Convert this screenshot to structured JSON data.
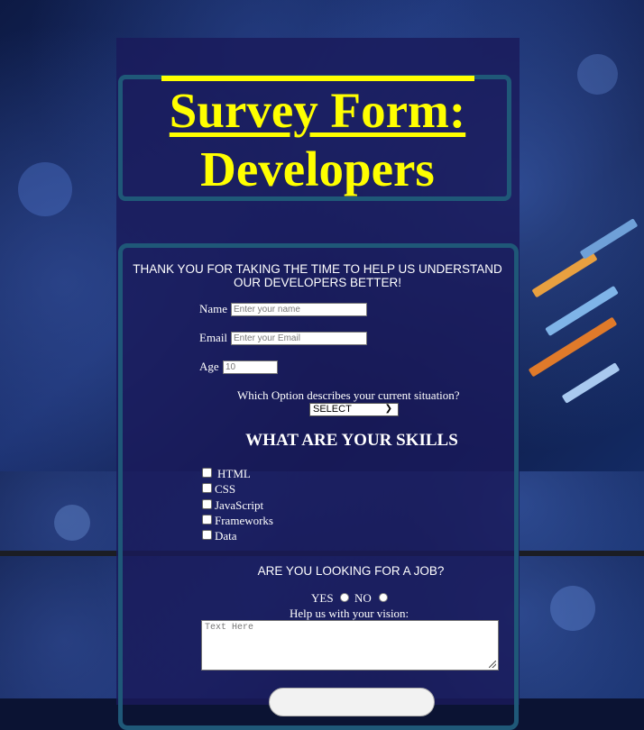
{
  "header": {
    "title_line1": "Survey Form:",
    "title_line2": "Developers"
  },
  "intro": "THANK YOU FOR TAKING THE TIME TO HELP US UNDERSTAND OUR DEVELOPERS BETTER!",
  "fields": {
    "name_label": "Name",
    "name_placeholder": "Enter your name",
    "email_label": "Email",
    "email_placeholder": "Enter your Email",
    "age_label": "Age",
    "age_placeholder": "10"
  },
  "situation": {
    "question": "Which Option describes your current situation?",
    "selected": "SELECT"
  },
  "skills": {
    "heading": "WHAT ARE YOUR SKILLS",
    "items": [
      "HTML",
      "CSS",
      "JavaScript",
      "Frameworks",
      "Data"
    ]
  },
  "job": {
    "question": "ARE YOU LOOKING FOR A JOB?",
    "yes_label": "YES",
    "no_label": "NO",
    "vision_label": "Help us with your vision:",
    "textarea_placeholder": "Text Here"
  },
  "colors": {
    "title": "#ffff00",
    "border": "#1f5878",
    "panel": "#1a1a5a"
  }
}
